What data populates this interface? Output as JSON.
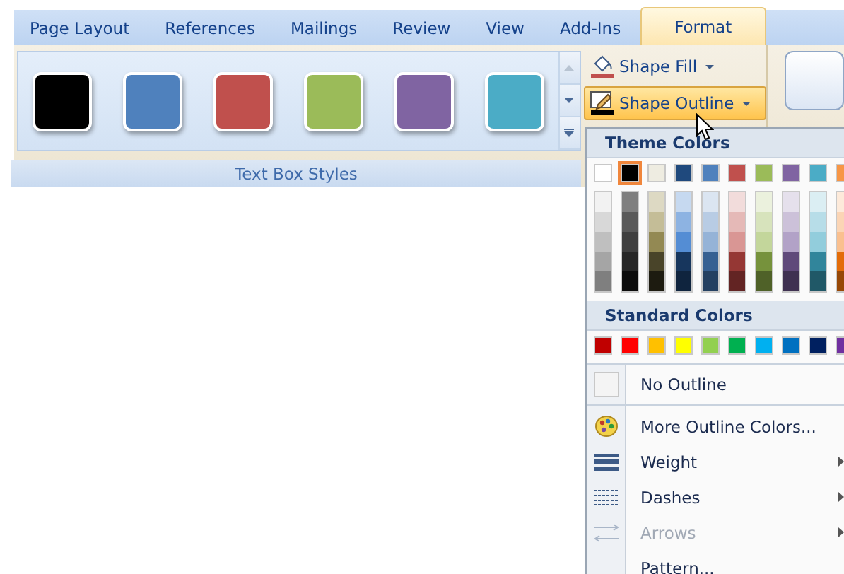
{
  "tabs": [
    {
      "label": "Page Layout",
      "selected": false
    },
    {
      "label": "References",
      "selected": false
    },
    {
      "label": "Mailings",
      "selected": false
    },
    {
      "label": "Review",
      "selected": false
    },
    {
      "label": "View",
      "selected": false
    },
    {
      "label": "Add-Ins",
      "selected": false
    },
    {
      "label": "Format",
      "selected": true
    }
  ],
  "style_gallery": {
    "styles": [
      {
        "color": "#000000"
      },
      {
        "color": "#4f81bd"
      },
      {
        "color": "#c0504d"
      },
      {
        "color": "#9bbb59"
      },
      {
        "color": "#8064a2"
      },
      {
        "color": "#4bacc6"
      }
    ],
    "group_label": "Text Box Styles"
  },
  "shape_buttons": [
    {
      "label": "Shape Fill",
      "kind": "fill",
      "highlighted": false
    },
    {
      "label": "Shape Outline",
      "kind": "outline",
      "highlighted": true
    }
  ],
  "outline_menu": {
    "theme_header": "Theme Colors",
    "theme_colors": [
      {
        "color": "#ffffff",
        "selected": false,
        "shades": [
          {
            "color": "#f2f2f2"
          },
          {
            "color": "#d8d8d8"
          },
          {
            "color": "#bfbfbf"
          },
          {
            "color": "#a5a5a5"
          },
          {
            "color": "#7f7f7f"
          }
        ]
      },
      {
        "color": "#000000",
        "selected": true,
        "shades": [
          {
            "color": "#7f7f7f"
          },
          {
            "color": "#595959"
          },
          {
            "color": "#3f3f3f"
          },
          {
            "color": "#262626"
          },
          {
            "color": "#0c0c0c"
          }
        ]
      },
      {
        "color": "#eeece1",
        "selected": false,
        "shades": [
          {
            "color": "#ddd9c3"
          },
          {
            "color": "#c4bd97"
          },
          {
            "color": "#938953"
          },
          {
            "color": "#494429"
          },
          {
            "color": "#1d1b10"
          }
        ]
      },
      {
        "color": "#1f497d",
        "selected": false,
        "shades": [
          {
            "color": "#c6d9f0"
          },
          {
            "color": "#8db3e2"
          },
          {
            "color": "#548dd4"
          },
          {
            "color": "#17365d"
          },
          {
            "color": "#0f243e"
          }
        ]
      },
      {
        "color": "#4f81bd",
        "selected": false,
        "shades": [
          {
            "color": "#dbe5f1"
          },
          {
            "color": "#b8cce4"
          },
          {
            "color": "#95b3d7"
          },
          {
            "color": "#366092"
          },
          {
            "color": "#244061"
          }
        ]
      },
      {
        "color": "#c0504d",
        "selected": false,
        "shades": [
          {
            "color": "#f2dcdb"
          },
          {
            "color": "#e5b9b7"
          },
          {
            "color": "#d99694"
          },
          {
            "color": "#953734"
          },
          {
            "color": "#632423"
          }
        ]
      },
      {
        "color": "#9bbb59",
        "selected": false,
        "shades": [
          {
            "color": "#ebf1dd"
          },
          {
            "color": "#d7e3bc"
          },
          {
            "color": "#c3d69b"
          },
          {
            "color": "#76923c"
          },
          {
            "color": "#4f6128"
          }
        ]
      },
      {
        "color": "#8064a2",
        "selected": false,
        "shades": [
          {
            "color": "#e5e0ec"
          },
          {
            "color": "#ccc1d9"
          },
          {
            "color": "#b2a2c7"
          },
          {
            "color": "#5f497a"
          },
          {
            "color": "#3f3151"
          }
        ]
      },
      {
        "color": "#4bacc6",
        "selected": false,
        "shades": [
          {
            "color": "#dbeef3"
          },
          {
            "color": "#b7dde8"
          },
          {
            "color": "#92cddc"
          },
          {
            "color": "#31859b"
          },
          {
            "color": "#205867"
          }
        ]
      },
      {
        "color": "#f79646",
        "selected": false,
        "shades": [
          {
            "color": "#fdeada"
          },
          {
            "color": "#fbd5b5"
          },
          {
            "color": "#fac08f"
          },
          {
            "color": "#e36c09"
          },
          {
            "color": "#974806"
          }
        ]
      }
    ],
    "standard_header": "Standard Colors",
    "standard_colors": [
      {
        "color": "#c00000",
        "selected": false
      },
      {
        "color": "#ff0000",
        "selected": false
      },
      {
        "color": "#ffc000",
        "selected": false
      },
      {
        "color": "#ffff00",
        "selected": false
      },
      {
        "color": "#92d050",
        "selected": false
      },
      {
        "color": "#00b050",
        "selected": false
      },
      {
        "color": "#00b0f0",
        "selected": false
      },
      {
        "color": "#0070c0",
        "selected": false
      },
      {
        "color": "#002060",
        "selected": false
      },
      {
        "color": "#7030a0",
        "selected": false
      }
    ],
    "items": [
      {
        "label": "No Outline",
        "kind": "none",
        "disabled": false,
        "submenu": false
      },
      {
        "label": "More Outline Colors...",
        "kind": "palette",
        "disabled": false,
        "submenu": false
      },
      {
        "label": "Weight",
        "kind": "weight",
        "disabled": false,
        "submenu": true
      },
      {
        "label": "Dashes",
        "kind": "dashes",
        "disabled": false,
        "submenu": true
      },
      {
        "label": "Arrows",
        "kind": "arrows",
        "disabled": true,
        "submenu": true
      },
      {
        "label": "Pattern...",
        "kind": "pattern",
        "disabled": false,
        "submenu": false
      }
    ]
  }
}
